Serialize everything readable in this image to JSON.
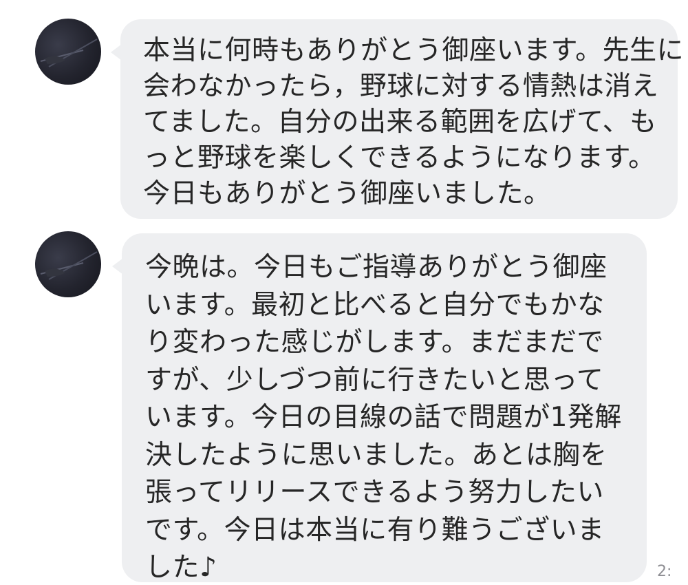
{
  "messages": [
    {
      "lines": [
        "本当に何時もありがとう御座います。先生に",
        "会わなかったら，野球に対する情熱は消え",
        "てました。自分の出来る範囲を広げて、も",
        "っと野球を楽しくできるようになります。",
        "今日もありがとう御座いました。"
      ]
    },
    {
      "lines": [
        "今晩は。今日もご指導ありがとう御座",
        "います。最初と比べると自分でもかな",
        "り変わった感じがします。まだまだで",
        "すが、少しづつ前に行きたいと思って",
        "います。今日の目線の話で問題が1発解",
        "決したように思いました。あとは胸を",
        "張ってリリースできるよう努力したい",
        "です。今日は本当に有り難うございま",
        "した♪"
      ]
    }
  ],
  "timestamp": "2:",
  "colors": {
    "bubble": "#eeeff1",
    "text": "#262626",
    "avatar": "#23242e",
    "timestamp": "#8e8e93"
  },
  "icons": {
    "avatar": "avatar-icon"
  }
}
